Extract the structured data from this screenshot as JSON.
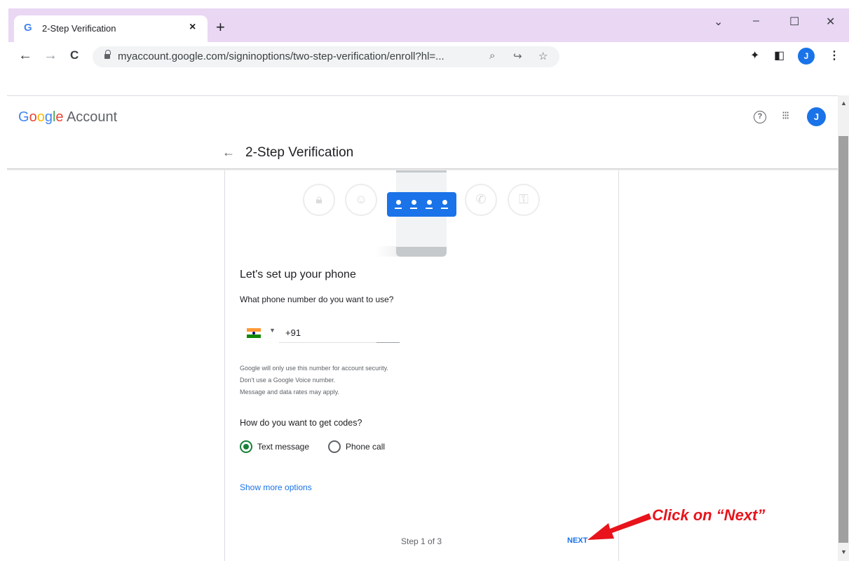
{
  "browser": {
    "tab_title": "2-Step Verification",
    "tab_favicon": "G",
    "tab_close": "×",
    "new_tab": "+",
    "window_controls": {
      "tabsearch": "⌄",
      "minimize": "–",
      "maximize": "☐",
      "close": "✕"
    },
    "nav": {
      "back": "←",
      "forward": "→",
      "reload": "C"
    },
    "url": "myaccount.google.com/signinoptions/two-step-verification/enroll?hl=...",
    "profile_initial": "J"
  },
  "header": {
    "logo": {
      "G": "G",
      "o1": "o",
      "o2": "o",
      "g": "g",
      "l": "l",
      "e": "e",
      "account": "Account"
    },
    "help": "?",
    "apps": "⁝⁝⁝",
    "avatar_initial": "J",
    "back": "←",
    "title": "2-Step Verification"
  },
  "illustration": {
    "icons": [
      "lock-icon",
      "account-icon",
      "otp-card-icon",
      "phone-icon",
      "key-icon"
    ]
  },
  "content": {
    "heading": "Let's set up your phone",
    "phone_question": "What phone number do you want to use?",
    "country_code": "+91",
    "disclaimer": [
      "Google will only use this number for account security.",
      "Don't use a Google Voice number.",
      "Message and data rates may apply."
    ],
    "codes_question": "How do you want to get codes?",
    "options": [
      {
        "label": "Text message",
        "selected": true
      },
      {
        "label": "Phone call",
        "selected": false
      }
    ],
    "more_options": "Show more options",
    "step": "Step 1 of 3",
    "next": "NEXT"
  },
  "annotation": {
    "text": "Click on “Next”",
    "color": "#e8131b"
  },
  "colors": {
    "tabstrip": "#e9d7f4",
    "accent": "#1a73e8",
    "radio_selected": "#188038"
  }
}
